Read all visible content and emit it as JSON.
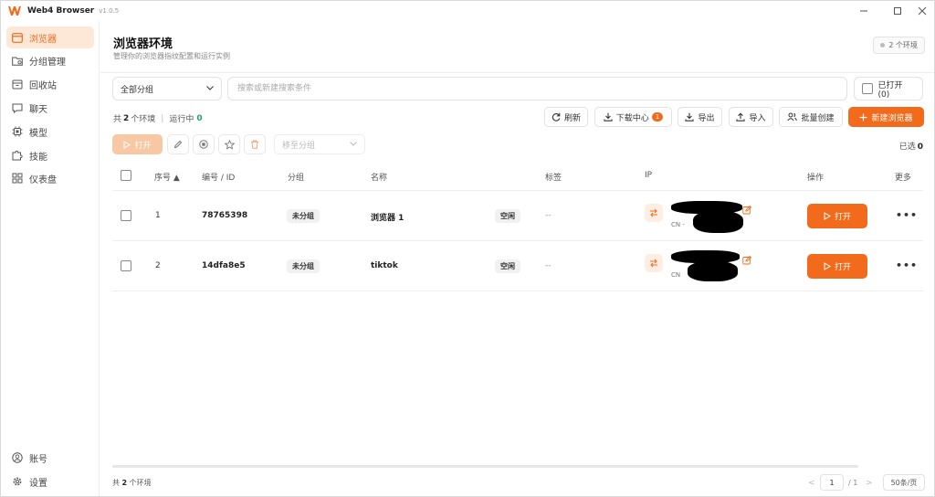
{
  "app": {
    "title": "Web4 Browser",
    "version": "v1.0.5"
  },
  "colors": {
    "accent": "#f26a1b",
    "accent_light": "#fde8d8",
    "running_green": "#20a36b"
  },
  "sidebar": {
    "items": [
      {
        "label": "浏览器",
        "icon": "browser-window-icon",
        "active": true
      },
      {
        "label": "分组管理",
        "icon": "folder-gear-icon"
      },
      {
        "label": "回收站",
        "icon": "recycle-bin-icon"
      },
      {
        "label": "聊天",
        "icon": "chat-bubble-icon"
      },
      {
        "label": "模型",
        "icon": "chip-icon"
      },
      {
        "label": "技能",
        "icon": "puzzle-icon"
      },
      {
        "label": "仪表盘",
        "icon": "dashboard-grid-icon"
      }
    ],
    "bottom": [
      {
        "label": "账号",
        "icon": "user-circle-icon"
      },
      {
        "label": "设置",
        "icon": "gear-icon"
      }
    ]
  },
  "header": {
    "title": "浏览器环境",
    "subtitle": "管理你的浏览器指纹配置和运行实例",
    "env_badge": "2 个环境"
  },
  "filters": {
    "group_select": "全部分组",
    "search_placeholder": "搜索或新建搜索条件",
    "opened_toggle": "已打开 (0)"
  },
  "summary": {
    "prefix": "共",
    "count": "2",
    "suffix": "个环境",
    "sep": "|",
    "running_label": "运行中",
    "running_count": "0"
  },
  "toolbar": {
    "refresh": "刷新",
    "download_center": "下载中心",
    "download_badge": "1",
    "export": "导出",
    "import": "导入",
    "batch_create": "批量创建",
    "new_browser": "新建浏览器"
  },
  "batch": {
    "open": "打开",
    "move_to_group": "移至分组",
    "selected_label": "已选",
    "selected_count": "0"
  },
  "table": {
    "columns": {
      "seq": "序号 ▲",
      "id": "编号 / ID",
      "group": "分组",
      "name": "名称",
      "tags": "标签",
      "ip": "IP",
      "action": "操作",
      "more": "更多"
    },
    "rows": [
      {
        "seq": "1",
        "id": "78765398",
        "group": "未分组",
        "name": "浏览器 1",
        "status": "空闲",
        "tags": "--",
        "ip_country": "CN - ",
        "open": "打开",
        "more": "•••"
      },
      {
        "seq": "2",
        "id": "14dfa8e5",
        "group": "未分组",
        "name": "tiktok",
        "status": "空闲",
        "tags": "--",
        "ip_country": "CN",
        "open": "打开",
        "more": "•••"
      }
    ]
  },
  "footer": {
    "total_prefix": "共",
    "total_count": "2",
    "total_suffix": "个环境",
    "prev": "<",
    "page": "1",
    "page_total": "/ 1",
    "next": ">",
    "per_page": "50条/页"
  }
}
